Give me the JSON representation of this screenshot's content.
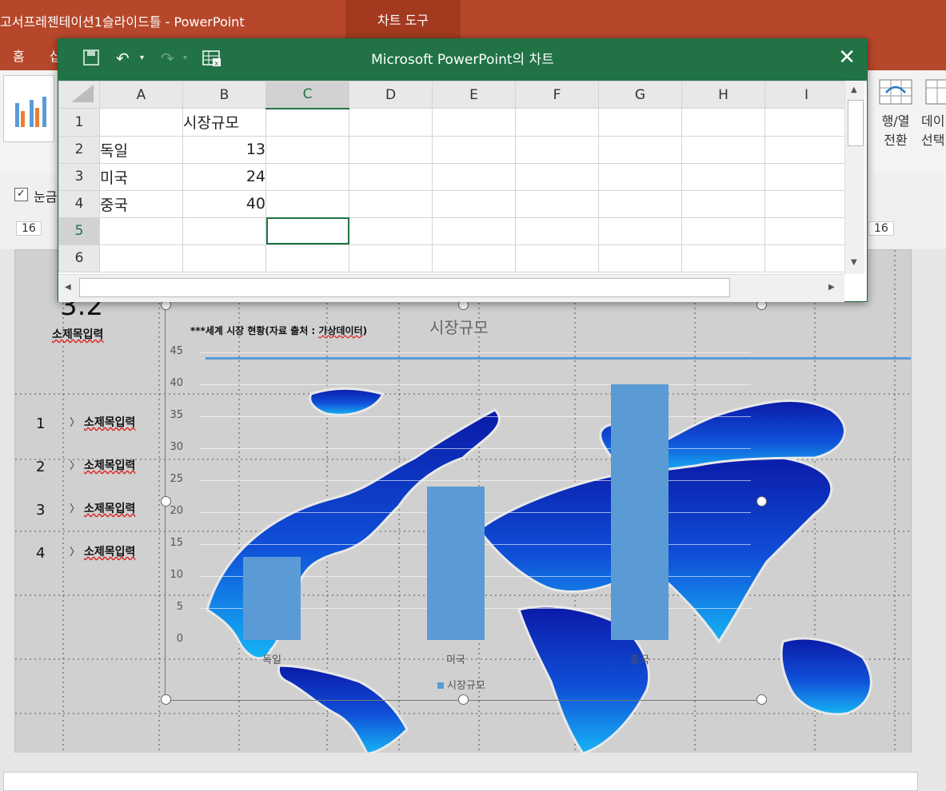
{
  "app": {
    "doc_title": "고서프레젠테이션1슬라이드틀 - PowerPoint",
    "context_tab": "차트 도구",
    "ribbon_tabs": [
      "홈",
      "삽"
    ],
    "ribbon_right": {
      "switch_row_col": "행/열\n전환",
      "switch_line1": "행/열",
      "switch_line2": "전환",
      "data_line1": "데이",
      "data_line2": "선택"
    },
    "gridlines_label": "눈금",
    "ruler_left": "16",
    "ruler_right": "16"
  },
  "excel": {
    "title": "Microsoft PowerPoint의 차트",
    "columns": [
      "A",
      "B",
      "C",
      "D",
      "E",
      "F",
      "G",
      "H",
      "I"
    ],
    "rows": [
      "1",
      "2",
      "3",
      "4",
      "5",
      "6"
    ],
    "header_cell": "시장규모",
    "categories": [
      "독일",
      "미국",
      "중국"
    ],
    "values": [
      "13",
      "24",
      "40"
    ]
  },
  "slide": {
    "section_number": "3.2",
    "section_title": "소제목입력",
    "toc": [
      {
        "num": "1",
        "label": "소제목입력"
      },
      {
        "num": "2",
        "label": "소제목입력"
      },
      {
        "num": "3",
        "label": "소제목입력"
      },
      {
        "num": "4",
        "label": "소제목입력"
      }
    ],
    "source_prefix": "***세계 시장 현황(자료 출처 : ",
    "source_underlined": "가상데이터",
    "source_suffix": ")"
  },
  "chart_data": {
    "type": "bar",
    "title": "시장규모",
    "categories": [
      "독일",
      "미국",
      "중국"
    ],
    "series": [
      {
        "name": "시장규모",
        "values": [
          13,
          24,
          40
        ]
      }
    ],
    "ylim": [
      0,
      45
    ],
    "yticks": [
      "0",
      "5",
      "10",
      "15",
      "20",
      "25",
      "30",
      "35",
      "40",
      "45"
    ],
    "legend": "bottom",
    "colors": {
      "bar": "#5b9bd5"
    }
  },
  "colors": {
    "ppt_accent": "#b7472a",
    "excel_accent": "#217346"
  }
}
